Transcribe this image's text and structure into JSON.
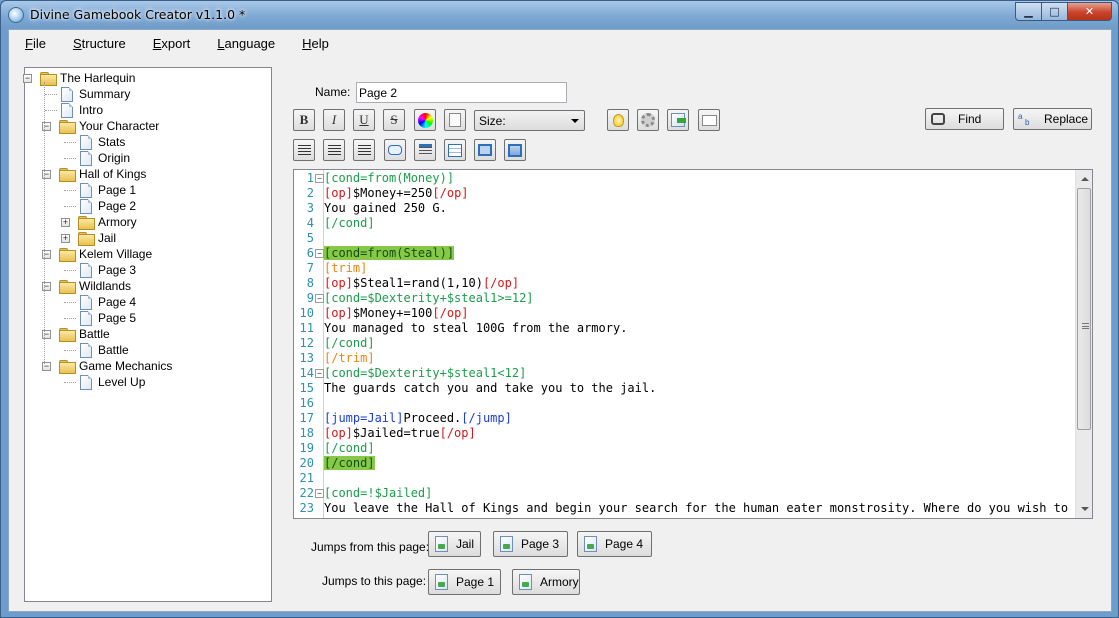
{
  "window": {
    "title": "Divine Gamebook Creator v1.1.0 *"
  },
  "caption_buttons": {
    "minimize": "▁",
    "maximize": "□",
    "close": "✕"
  },
  "menu": [
    {
      "underline": "F",
      "rest": "ile"
    },
    {
      "underline": "S",
      "rest": "tructure"
    },
    {
      "underline": "E",
      "rest": "xport"
    },
    {
      "underline": "L",
      "rest": "anguage"
    },
    {
      "underline": "H",
      "rest": "elp"
    }
  ],
  "tree": {
    "root": "The Harlequin",
    "items": [
      {
        "label": "The Harlequin",
        "kind": "folder",
        "level": 0
      },
      {
        "label": "Summary",
        "kind": "page",
        "level": 1
      },
      {
        "label": "Intro",
        "kind": "page",
        "level": 1
      },
      {
        "label": "Your Character",
        "kind": "folder",
        "level": 1
      },
      {
        "label": "Stats",
        "kind": "page",
        "level": 2
      },
      {
        "label": "Origin",
        "kind": "page",
        "level": 2
      },
      {
        "label": "Hall of Kings",
        "kind": "folder",
        "level": 1
      },
      {
        "label": "Page 1",
        "kind": "page",
        "level": 2
      },
      {
        "label": "Page 2",
        "kind": "page",
        "level": 2
      },
      {
        "label": "Armory",
        "kind": "folder",
        "level": 2
      },
      {
        "label": "Jail",
        "kind": "folder",
        "level": 2
      },
      {
        "label": "Kelem Village",
        "kind": "folder",
        "level": 1
      },
      {
        "label": "Page 3",
        "kind": "page",
        "level": 2
      },
      {
        "label": "Wildlands",
        "kind": "folder",
        "level": 1
      },
      {
        "label": "Page 4",
        "kind": "page",
        "level": 2
      },
      {
        "label": "Page 5",
        "kind": "page",
        "level": 2
      },
      {
        "label": "Battle",
        "kind": "folder",
        "level": 1
      },
      {
        "label": "Battle",
        "kind": "page",
        "level": 2
      },
      {
        "label": "Game Mechanics",
        "kind": "folder",
        "level": 1
      },
      {
        "label": "Level Up",
        "kind": "page",
        "level": 2
      }
    ]
  },
  "name_field": {
    "label": "Name:",
    "value": "Page 2"
  },
  "toolbar": {
    "bold": "B",
    "italic": "I",
    "underline": "U",
    "strike": "S",
    "size_label": "Size:",
    "find": "Find",
    "replace": "Replace"
  },
  "editor": {
    "lines": [
      {
        "n": "1",
        "fold": "−",
        "parts": [
          {
            "t": "[cond=from(Money)]",
            "c": "green"
          }
        ]
      },
      {
        "n": "2",
        "parts": [
          {
            "t": "[op]",
            "c": "red"
          },
          {
            "t": "$Money+=250",
            "c": "black"
          },
          {
            "t": "[/op]",
            "c": "red"
          }
        ]
      },
      {
        "n": "3",
        "parts": [
          {
            "t": "You gained 250 G.",
            "c": "black"
          }
        ]
      },
      {
        "n": "4",
        "parts": [
          {
            "t": "[/cond]",
            "c": "green"
          }
        ]
      },
      {
        "n": "5",
        "parts": []
      },
      {
        "n": "6",
        "fold": "−",
        "parts": [
          {
            "t": "[cond=from(Steal)]",
            "c": "green",
            "hl": true
          }
        ]
      },
      {
        "n": "7",
        "parts": [
          {
            "t": "[trim]",
            "c": "orange"
          }
        ]
      },
      {
        "n": "8",
        "parts": [
          {
            "t": "[op]",
            "c": "red"
          },
          {
            "t": "$Steal1=rand(1,10)",
            "c": "black"
          },
          {
            "t": "[/op]",
            "c": "red"
          }
        ]
      },
      {
        "n": "9",
        "fold": "−",
        "parts": [
          {
            "t": "[cond=$Dexterity+$steal1>=12]",
            "c": "green"
          }
        ]
      },
      {
        "n": "10",
        "parts": [
          {
            "t": "[op]",
            "c": "red"
          },
          {
            "t": "$Money+=100",
            "c": "black"
          },
          {
            "t": "[/op]",
            "c": "red"
          }
        ]
      },
      {
        "n": "11",
        "parts": [
          {
            "t": "You managed to steal 100G from the armory.",
            "c": "black"
          }
        ]
      },
      {
        "n": "12",
        "parts": [
          {
            "t": "[/cond]",
            "c": "green"
          }
        ]
      },
      {
        "n": "13",
        "parts": [
          {
            "t": "[/trim]",
            "c": "orange"
          }
        ]
      },
      {
        "n": "14",
        "fold": "−",
        "parts": [
          {
            "t": "[cond=$Dexterity+$steal1<12]",
            "c": "green"
          }
        ]
      },
      {
        "n": "15",
        "parts": [
          {
            "t": "The guards catch you and take you to the jail.",
            "c": "black"
          }
        ]
      },
      {
        "n": "16",
        "parts": []
      },
      {
        "n": "17",
        "parts": [
          {
            "t": "[jump=Jail]",
            "c": "blue"
          },
          {
            "t": "Proceed.",
            "c": "black"
          },
          {
            "t": "[/jump]",
            "c": "blue"
          }
        ]
      },
      {
        "n": "18",
        "parts": [
          {
            "t": "[op]",
            "c": "red"
          },
          {
            "t": "$Jailed=true",
            "c": "black"
          },
          {
            "t": "[/op]",
            "c": "red"
          }
        ]
      },
      {
        "n": "19",
        "parts": [
          {
            "t": "[/cond]",
            "c": "green"
          }
        ]
      },
      {
        "n": "20",
        "parts": [
          {
            "t": "[/cond]",
            "c": "green",
            "hl": true
          }
        ]
      },
      {
        "n": "21",
        "parts": []
      },
      {
        "n": "22",
        "fold": "−",
        "parts": [
          {
            "t": "[cond=!$Jailed]",
            "c": "green"
          }
        ]
      },
      {
        "n": "23",
        "parts": [
          {
            "t": "You leave the Hall of Kings and begin your search for the human eater monstrosity. Where do you wish to",
            "c": "black"
          }
        ]
      }
    ]
  },
  "jumps": {
    "from_label": "Jumps from this page:",
    "from": [
      "Jail",
      "Page 3",
      "Page 4"
    ],
    "to_label": "Jumps to this page:",
    "to": [
      "Page 1",
      "Armory"
    ]
  }
}
